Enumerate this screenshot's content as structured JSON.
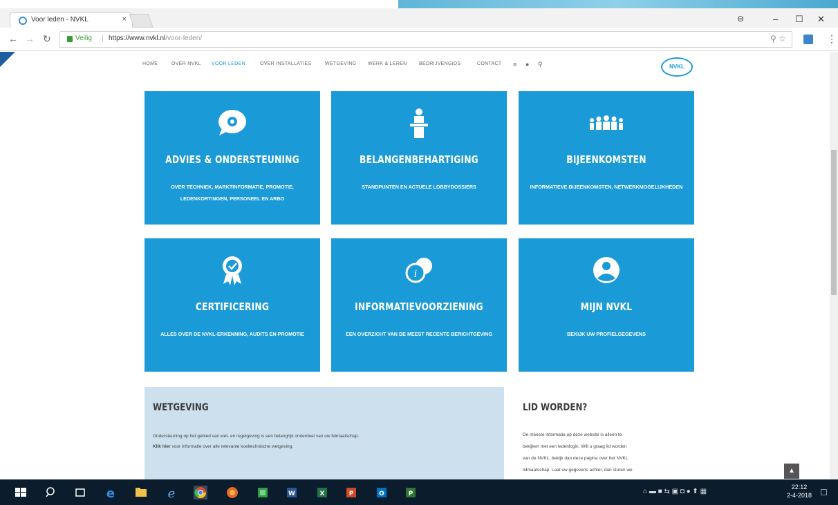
{
  "browser": {
    "tab_title": "Voor leden - NVKL",
    "tab_close": "×",
    "secure_label": "Veilig",
    "url_host": "https://www.nvkl.nl",
    "url_path": "/voor-leden/",
    "window_controls": [
      "–",
      "☐",
      "✕"
    ]
  },
  "site": {
    "nav": [
      "HOME",
      "OVER NVKL",
      "VOOR LEDEN",
      "OVER INSTALLATIES",
      "WETGEVING",
      "WERK & LEREN",
      "BEDRIJVENGIDS",
      "CONTACT"
    ],
    "nav_active": "VOOR LEDEN",
    "logo_text": "NVKL"
  },
  "tiles": [
    {
      "icon": "chat-gear-icon",
      "title": "ADVIES & ONDERSTEUNING",
      "subtitle": "OVER TECHNIEK, MARKTINFORMATIE, PROMOTIE, LEDENKORTINGEN, PERSONEEL EN ARBO"
    },
    {
      "icon": "speaker-podium-icon",
      "title": "BELANGENBEHARTIGING",
      "subtitle": "STANDPUNTEN EN ACTUELE LOBBYDOSSIERS"
    },
    {
      "icon": "group-icon",
      "title": "BIJEENKOMSTEN",
      "subtitle": "INFORMATIEVE BIJEENKOMSTEN, NETWERKMOGELIJKHEDEN"
    },
    {
      "icon": "award-badge-icon",
      "title": "CERTIFICERING",
      "subtitle": "ALLES OVER DE NVKL-ERKENNING, AUDITS EN PROMOTIE"
    },
    {
      "icon": "info-bubble-icon",
      "title": "INFORMATIEVOORZIENING",
      "subtitle": "EEN OVERZICHT VAN DE MEEST RECENTE BERICHTGEVING"
    },
    {
      "icon": "user-circle-icon",
      "title": "MIJN NVKL",
      "subtitle": "BEKIJK UW PROFIELGEGEVENS"
    }
  ],
  "wetgeving": {
    "title": "WETGEVING",
    "line1": "Ondersteuning op het gebied van wet- en regelgeving is een belangrijk onderdeel van uw lidmaatschap.",
    "link": "Klik hier",
    "line2": " voor informatie over alle relevante koeltechnische wetgeving."
  },
  "lid": {
    "title": "LID WORDEN?",
    "lines": [
      "De meeste informatie op deze website is alleen te",
      "bekijken met een ledenlogin. Wilt u graag lid worden",
      "van de NVKL, bekijk dan deze pagina over het NVKL",
      "lidmaatschap. Laat uw gegevens achter, dan sturen we"
    ]
  },
  "taskbar": {
    "time": "22:12",
    "date": "2-4-2018"
  },
  "colors": {
    "tile_blue": "#1a9ad6",
    "wetgeving_bg": "#cde0ee",
    "taskbar": "#0b1c2c"
  }
}
